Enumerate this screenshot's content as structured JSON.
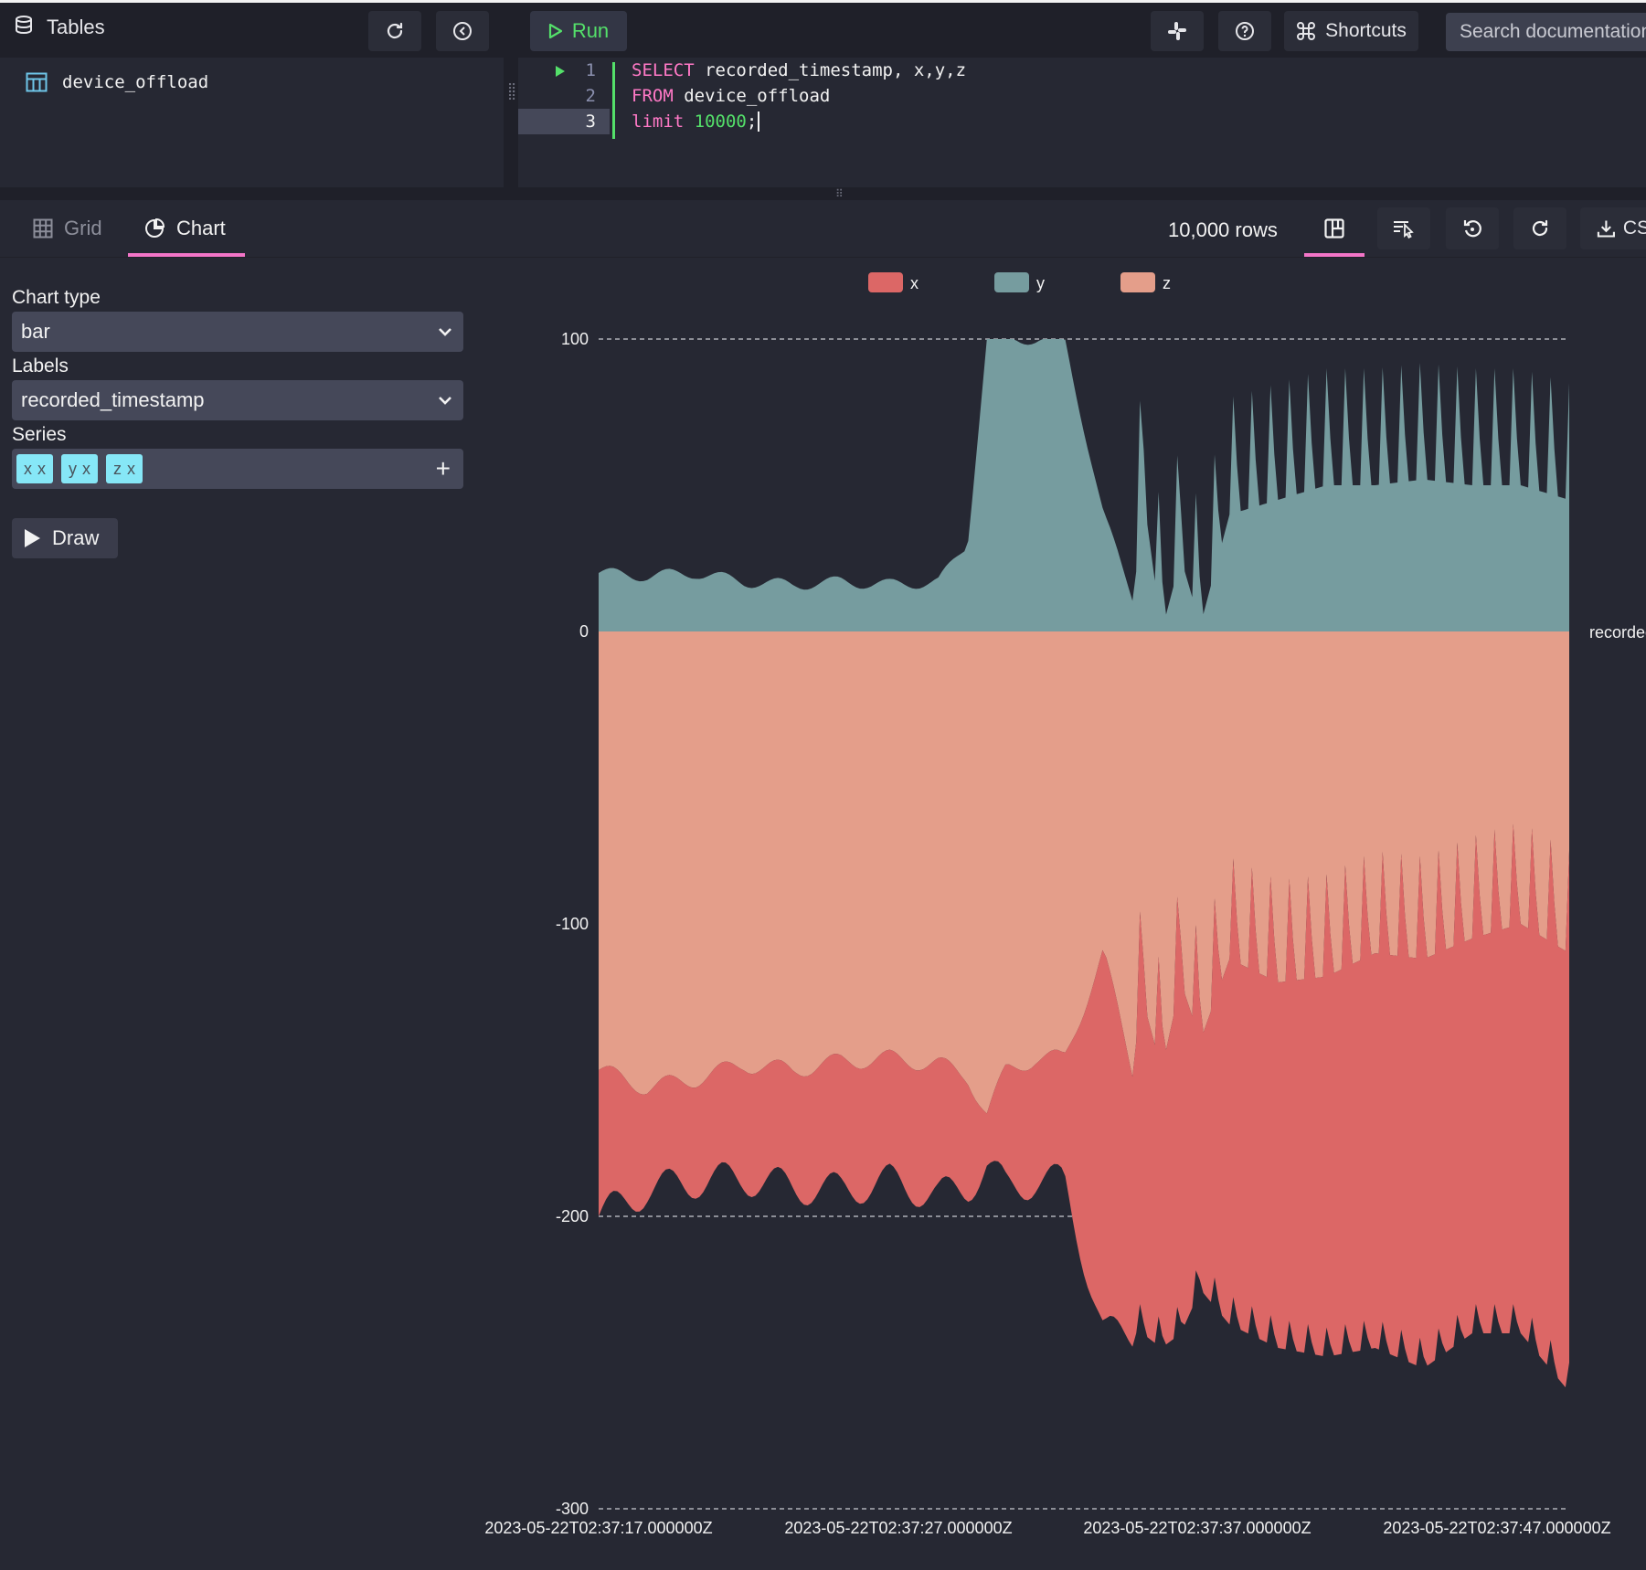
{
  "topbar": {
    "tables_title": "Tables",
    "run_label": "Run",
    "shortcuts_label": "Shortcuts",
    "search_placeholder": "Search documentation"
  },
  "tables": [
    {
      "name": "device_offload"
    }
  ],
  "editor": {
    "lines": [
      {
        "number": "1",
        "keyword": "SELECT",
        "rest": " recorded_timestamp, x,y,z"
      },
      {
        "number": "2",
        "keyword": "FROM",
        "rest": " device_offload"
      },
      {
        "number": "3",
        "keyword": "limit",
        "value": "10000",
        "rest": ";"
      }
    ]
  },
  "results": {
    "tabs": {
      "grid": "Grid",
      "chart": "Chart"
    },
    "row_count": "10,000 rows",
    "csv_label": "CSV"
  },
  "settings": {
    "chart_type_label": "Chart type",
    "chart_type_value": "bar",
    "labels_label": "Labels",
    "labels_value": "recorded_timestamp",
    "series_label": "Series",
    "series": [
      {
        "name": "x",
        "remove": "x"
      },
      {
        "name": "y",
        "remove": "x"
      },
      {
        "name": "z",
        "remove": "x"
      }
    ],
    "add_symbol": "+",
    "draw_label": "Draw"
  },
  "chart_data": {
    "type": "bar",
    "stacked": true,
    "x_axis_label": "recorded_timestamp",
    "x_ticks": [
      "2023-05-22T02:37:17.000000Z",
      "2023-05-22T02:37:27.000000Z",
      "2023-05-22T02:37:37.000000Z",
      "2023-05-22T02:37:47.000000Z"
    ],
    "y_ticks": [
      100,
      0,
      -100,
      -200,
      -300
    ],
    "ylim": [
      -300,
      100
    ],
    "legend_position": "top-center",
    "grid": "dashed horizontal at 100 and -200",
    "series": [
      {
        "name": "x",
        "color": "#dc6766"
      },
      {
        "name": "y",
        "color": "#769c9f"
      },
      {
        "name": "z",
        "color": "#e49e8a"
      }
    ],
    "samples": {
      "t_fraction": [
        0.0,
        0.05,
        0.1,
        0.15,
        0.2,
        0.25,
        0.3,
        0.35,
        0.38,
        0.4,
        0.42,
        0.45,
        0.48,
        0.52,
        0.55,
        0.56,
        0.58,
        0.6,
        0.62,
        0.65,
        0.7,
        0.75,
        0.8,
        0.85,
        0.9,
        0.95,
        1.0
      ],
      "y": [
        20,
        19,
        20,
        17,
        16,
        17,
        16,
        17,
        30,
        100,
        100,
        100,
        100,
        40,
        12,
        60,
        10,
        35,
        12,
        50,
        55,
        60,
        60,
        62,
        60,
        60,
        55
      ],
      "z": [
        -150,
        -156,
        -153,
        -148,
        -150,
        -147,
        -146,
        -148,
        -152,
        -165,
        -150,
        -146,
        -146,
        -110,
        -150,
        -125,
        -150,
        -120,
        -140,
        -112,
        -120,
        -118,
        -110,
        -112,
        -105,
        -100,
        -110
      ],
      "x": [
        -50,
        -35,
        -35,
        -39,
        -40,
        -44,
        -42,
        -45,
        -38,
        -18,
        -40,
        -42,
        -42,
        -130,
        -90,
        -115,
        -95,
        -120,
        -85,
        -125,
        -125,
        -130,
        -135,
        -140,
        -135,
        -140,
        -150
      ]
    }
  }
}
